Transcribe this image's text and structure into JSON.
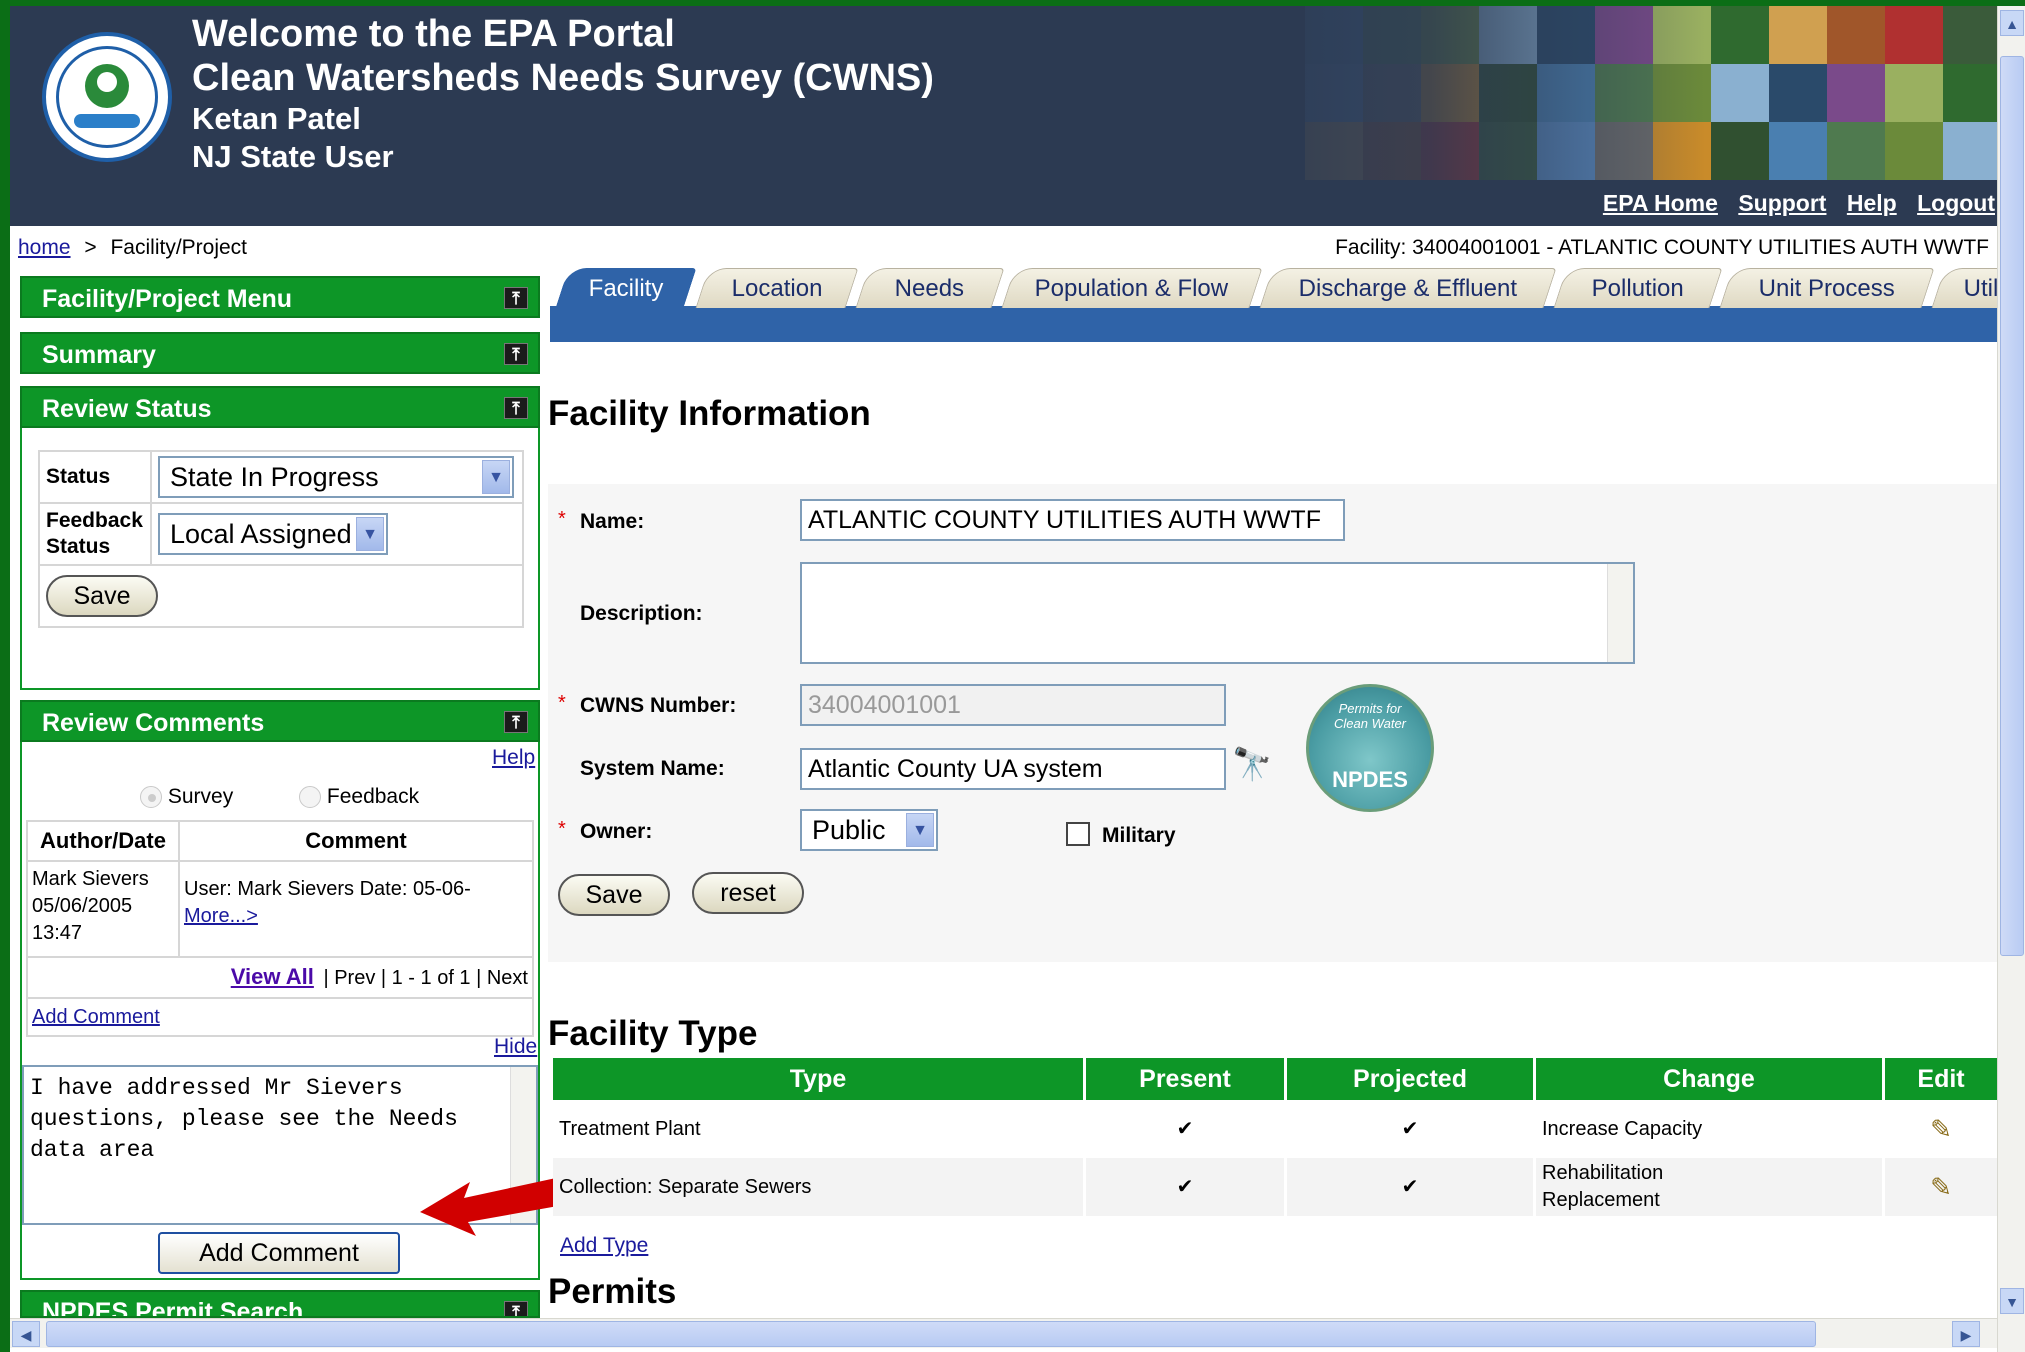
{
  "header": {
    "title_line1": "Welcome to the EPA Portal",
    "title_line2": "Clean Watersheds Needs Survey (CWNS)",
    "user_name": "Ketan Patel",
    "user_role": "NJ State User",
    "links": [
      "EPA Home",
      "Support",
      "Help",
      "Logout"
    ]
  },
  "breadcrumb": {
    "home": "home",
    "separator": ">",
    "current": "Facility/Project"
  },
  "facility_label": "Facility: 34004001001 - ATLANTIC COUNTY UTILITIES AUTH WWTF",
  "sidebar": {
    "panels": [
      "Facility/Project Menu",
      "Summary",
      "Review Status",
      "Review Comments",
      "NPDES Permit Search"
    ],
    "pin_glyph": "⤒",
    "review_status": {
      "status_label": "Status",
      "status_value": "State In Progress",
      "feedback_label_1": "Feedback",
      "feedback_label_2": "Status",
      "feedback_value": "Local Assigned",
      "save_label": "Save"
    },
    "review_comments": {
      "help_link": "Help",
      "radio_survey": "Survey",
      "radio_feedback": "Feedback",
      "col_author": "Author/Date",
      "col_comment": "Comment",
      "row": {
        "author": "Mark Sievers",
        "date": "05/06/2005",
        "time": "13:47",
        "comment": "User: Mark Sievers Date: 05-06-",
        "more": "More...>"
      },
      "view_all": "View All",
      "pager": "| Prev | 1 - 1 of 1 | Next",
      "add_comment_link": "Add Comment",
      "hide_link": "Hide",
      "textarea_value": "I have addressed Mr Sievers questions, please see the Needs data area",
      "add_comment_button": "Add Comment"
    }
  },
  "tabs": [
    "Facility",
    "Location",
    "Needs",
    "Population & Flow",
    "Discharge & Effluent",
    "Pollution",
    "Unit Process",
    "Utility"
  ],
  "active_tab": "Facility",
  "facility_info": {
    "heading": "Facility Information",
    "req_marker": "*",
    "name_label": "Name:",
    "name_value": "ATLANTIC COUNTY UTILITIES AUTH WWTF",
    "description_label": "Description:",
    "description_value": "",
    "cwns_label": "CWNS Number:",
    "cwns_value": "34004001001",
    "system_label": "System Name:",
    "system_value": "Atlantic County UA system",
    "owner_label": "Owner:",
    "owner_value": "Public",
    "military_label": "Military",
    "save_label": "Save",
    "reset_label": "reset",
    "npdes_badge": "NPDES",
    "npdes_arc": "Permits for Clean Water"
  },
  "facility_type": {
    "heading": "Facility Type",
    "columns": [
      "Type",
      "Present",
      "Projected",
      "Change",
      "Edit"
    ],
    "rows": [
      {
        "type": "Treatment Plant",
        "present": "✔",
        "projected": "✔",
        "change_1": "Increase Capacity",
        "change_2": ""
      },
      {
        "type": "Collection: Separate Sewers",
        "present": "✔",
        "projected": "✔",
        "change_1": "Rehabilitation",
        "change_2": "Replacement"
      }
    ],
    "add_link": "Add Type"
  },
  "permits_heading": "Permits",
  "colors": {
    "green": "#0d9627",
    "header_bg": "#2c3a52",
    "tab_blue": "#2f63a8",
    "arrow": "#d10000"
  }
}
